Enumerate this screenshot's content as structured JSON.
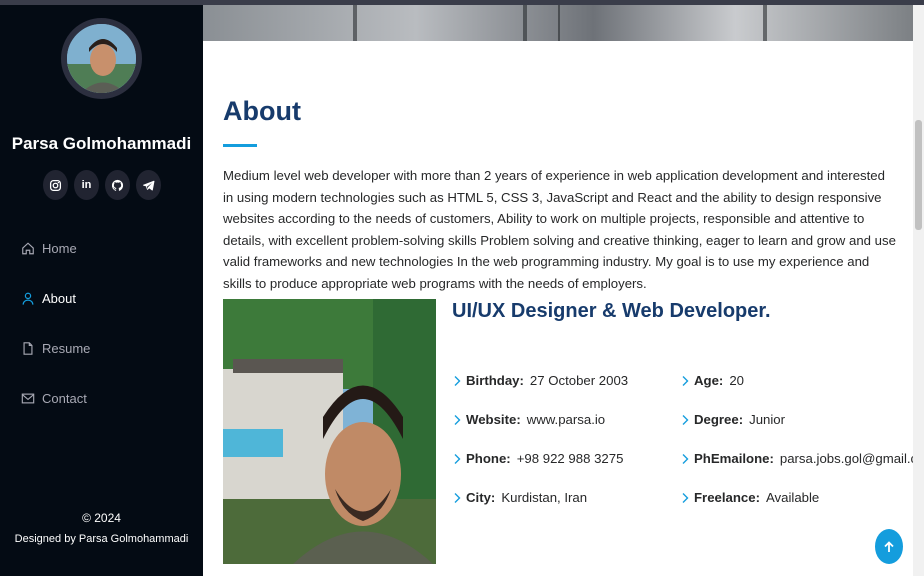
{
  "sidebar": {
    "name": "Parsa Golmohammadi",
    "socials": [
      {
        "icon": "instagram-icon"
      },
      {
        "icon": "linkedin-icon",
        "glyph": "in"
      },
      {
        "icon": "github-icon"
      },
      {
        "icon": "telegram-icon"
      }
    ],
    "nav": [
      {
        "label": "Home",
        "icon": "home-icon",
        "active": false
      },
      {
        "label": "About",
        "icon": "person-icon",
        "active": true
      },
      {
        "label": "Resume",
        "icon": "file-icon",
        "active": false
      },
      {
        "label": "Contact",
        "icon": "envelope-icon",
        "active": false
      }
    ],
    "footer": {
      "copyright": "© 2024",
      "credit": "Designed by Parsa Golmohammadi"
    }
  },
  "about": {
    "title": "About",
    "description": "Medium level web developer with more than 2 years of experience in web application development and interested in using modern technologies such as HTML 5, CSS 3, JavaScript and React and the ability to design responsive websites according to the needs of customers, Ability to work on multiple projects, responsible and attentive to details, with excellent problem-solving skills Problem solving and creative thinking, eager to learn and grow and use valid frameworks and new technologies In the web programming industry. My goal is to use my experience and skills to produce appropriate web programs with the needs of employers.",
    "role": "UI/UX Designer & Web Developer.",
    "info": {
      "birthday": {
        "label": "Birthday:",
        "value": "27 October 2003"
      },
      "website": {
        "label": "Website:",
        "value": "www.parsa.io"
      },
      "phone": {
        "label": "Phone:",
        "value": "+98 922 988 3275"
      },
      "city": {
        "label": "City:",
        "value": "Kurdistan, Iran"
      },
      "age": {
        "label": "Age:",
        "value": "20"
      },
      "degree": {
        "label": "Degree:",
        "value": "Junior"
      },
      "email": {
        "label": "PhEmailone:",
        "value": "parsa.jobs.gol@gmail.com"
      },
      "freelance": {
        "label": "Freelance:",
        "value": "Available"
      }
    }
  },
  "colors": {
    "sidebar_bg": "#040b14",
    "accent": "#149ddd",
    "heading": "#173b6c"
  },
  "back_to_top_icon": "arrow-up-icon"
}
